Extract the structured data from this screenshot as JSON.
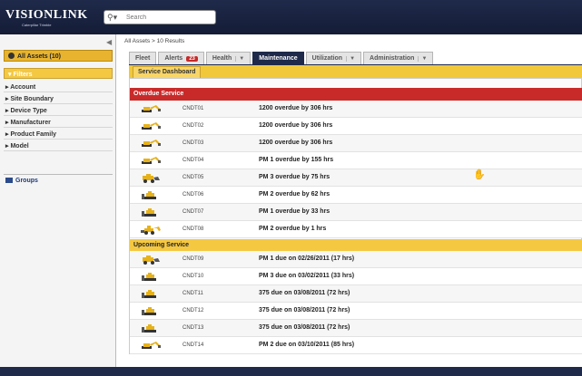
{
  "header": {
    "logo": "VISIONLINK",
    "logo_tagline": "Caterpillar Trimble",
    "search_placeholder": "Search"
  },
  "sidebar": {
    "all_assets_label": "All Assets (10)",
    "filters_label": "Filters",
    "filters": [
      "Account",
      "Site Boundary",
      "Device Type",
      "Manufacturer",
      "Product Family",
      "Model"
    ],
    "groups_label": "Groups"
  },
  "breadcrumb": "All Assets > 10 Results",
  "tabs": [
    {
      "label": "Fleet",
      "dropdown": false
    },
    {
      "label": "Alerts",
      "badge": "23",
      "dropdown": false
    },
    {
      "label": "Health",
      "dropdown": true
    },
    {
      "label": "Maintenance",
      "dropdown": false,
      "active": true
    },
    {
      "label": "Utilization",
      "dropdown": true
    },
    {
      "label": "Administration",
      "dropdown": true
    }
  ],
  "subtab": "Service Dashboard",
  "sections": {
    "overdue": "Overdue Service",
    "upcoming": "Upcoming Service"
  },
  "overdue_rows": [
    {
      "machine": "excavator",
      "asset": "CNDT01",
      "service": "1200  overdue by  306 hrs"
    },
    {
      "machine": "excavator",
      "asset": "CNDT02",
      "service": "1200  overdue by  306 hrs"
    },
    {
      "machine": "excavator",
      "asset": "CNDT03",
      "service": "1200  overdue by  306 hrs"
    },
    {
      "machine": "excavator",
      "asset": "CNDT04",
      "service": "PM 1  overdue by  155 hrs"
    },
    {
      "machine": "wheel-loader",
      "asset": "CNDT05",
      "service": "PM 3  overdue by  75 hrs"
    },
    {
      "machine": "dozer",
      "asset": "CNDT06",
      "service": "PM 2  overdue by  62 hrs"
    },
    {
      "machine": "dozer",
      "asset": "CNDT07",
      "service": "PM 1  overdue by  33 hrs"
    },
    {
      "machine": "backhoe",
      "asset": "CNDT08",
      "service": "PM 2  overdue by  1 hrs"
    }
  ],
  "upcoming_rows": [
    {
      "machine": "wheel-loader",
      "asset": "CNDT09",
      "service": "PM 1  due on  02/26/2011 (17 hrs)"
    },
    {
      "machine": "dozer",
      "asset": "CNDT10",
      "service": "PM 3  due on  03/02/2011 (33 hrs)"
    },
    {
      "machine": "dozer",
      "asset": "CNDT11",
      "service": "375  due on  03/08/2011 (72 hrs)"
    },
    {
      "machine": "dozer",
      "asset": "CNDT12",
      "service": "375  due on  03/08/2011 (72 hrs)"
    },
    {
      "machine": "dozer",
      "asset": "CNDT13",
      "service": "375  due on  03/08/2011 (72 hrs)"
    },
    {
      "machine": "excavator",
      "asset": "CNDT14",
      "service": "PM 2  due on  03/10/2011 (85 hrs)"
    }
  ],
  "colors": {
    "nav_dark": "#1f2a4a",
    "overdue_red": "#c82a2a",
    "upcoming_yellow": "#f5c842",
    "machine_yellow": "#e6b21c"
  }
}
